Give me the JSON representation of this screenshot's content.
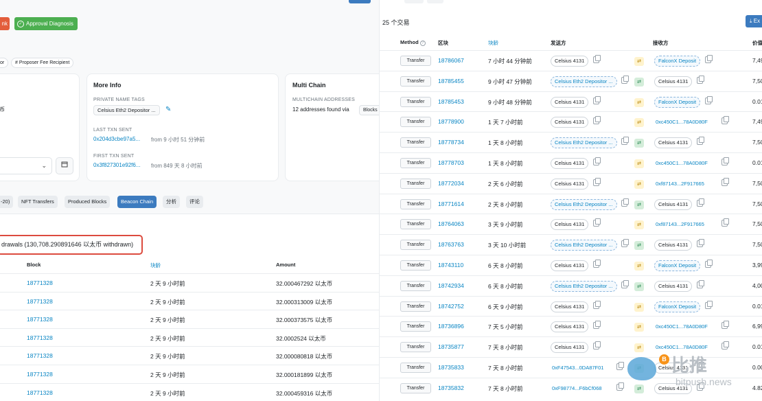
{
  "left": {
    "top_buttons": {
      "dark": "nk",
      "green": "Approval Diagnosis"
    },
    "chips": [
      "or",
      "# Proposer Fee Recipient"
    ],
    "overview_fragment": "币",
    "more_info": {
      "title": "More Info",
      "private_tags_label": "PRIVATE NAME TAGS",
      "private_tag": "Celsius Eth2 Depositor ...",
      "last_txn_label": "LAST TXN SENT",
      "last_txn_hash": "0x204d3cbe97a5...",
      "last_txn_time": "from 9 小时 51 分钟前",
      "first_txn_label": "FIRST TXN SENT",
      "first_txn_hash": "0x3f827301e92f6...",
      "first_txn_time": "from 849 天 8 小时前"
    },
    "multichain": {
      "title": "Multi Chain",
      "label": "MULTICHAIN ADDRESSES",
      "text": "12 addresses found via",
      "badge": "Blocks"
    },
    "tabs": [
      "-20)",
      "NFT Transfers",
      "Produced Blocks",
      "Beacon Chain",
      "分析",
      "评论"
    ],
    "active_tab": "Beacon Chain",
    "withdrawals_title": "drawals (130,708.290891646 以太币 withdrawn)",
    "table_headers": {
      "block": "Block",
      "age": "块龄",
      "amount": "Amount"
    },
    "rows": [
      {
        "block": "18771328",
        "age": "2 天 9 小时前",
        "amount": "32.000467292 以太币"
      },
      {
        "block": "18771328",
        "age": "2 天 9 小时前",
        "amount": "32.000313009 以太币"
      },
      {
        "block": "18771328",
        "age": "2 天 9 小时前",
        "amount": "32.000373575 以太币"
      },
      {
        "block": "18771328",
        "age": "2 天 9 小时前",
        "amount": "32.0002524 以太币"
      },
      {
        "block": "18771328",
        "age": "2 天 9 小时前",
        "amount": "32.000080818 以太币"
      },
      {
        "block": "18771328",
        "age": "2 天 9 小时前",
        "amount": "32.000181899 以太币"
      },
      {
        "block": "18771328",
        "age": "2 天 9 小时前",
        "amount": "32.000459316 以太币"
      }
    ]
  },
  "right": {
    "count": "25 个交易",
    "export": "Ex",
    "headers": {
      "method": "Method",
      "block": "区块",
      "age": "块龄",
      "from": "发送方",
      "to": "接收方",
      "value": "价值"
    },
    "rows": [
      {
        "method": "Transfer",
        "block": "18786067",
        "age": "7 小时 44 分钟前",
        "from": "Celsius 4131",
        "from_style": "plain",
        "dir": "out",
        "to": "FalconX Deposit",
        "to_style": "dash",
        "value": "7,49"
      },
      {
        "method": "Transfer",
        "block": "18785455",
        "age": "9 小时 47 分钟前",
        "from": "Celsius Eth2 Depositor ...",
        "from_style": "dash",
        "dir": "in",
        "to": "Celsius 4131",
        "to_style": "plain",
        "value": "7,50"
      },
      {
        "method": "Transfer",
        "block": "18785453",
        "age": "9 小时 48 分钟前",
        "from": "Celsius 4131",
        "from_style": "plain",
        "dir": "out",
        "to": "FalconX Deposit",
        "to_style": "dash",
        "value": "0.01"
      },
      {
        "method": "Transfer",
        "block": "18778900",
        "age": "1 天 7 小时前",
        "from": "Celsius 4131",
        "from_style": "plain",
        "dir": "out",
        "to": "0xc450C1...78A0D80F",
        "to_style": "link",
        "value": "7,49"
      },
      {
        "method": "Transfer",
        "block": "18778734",
        "age": "1 天 8 小时前",
        "from": "Celsius Eth2 Depositor ...",
        "from_style": "dash",
        "dir": "in",
        "to": "Celsius 4131",
        "to_style": "plain",
        "value": "7,50"
      },
      {
        "method": "Transfer",
        "block": "18778703",
        "age": "1 天 8 小时前",
        "from": "Celsius 4131",
        "from_style": "plain",
        "dir": "out",
        "to": "0xc450C1...78A0D80F",
        "to_style": "link",
        "value": "0.01"
      },
      {
        "method": "Transfer",
        "block": "18772034",
        "age": "2 天 6 小时前",
        "from": "Celsius 4131",
        "from_style": "plain",
        "dir": "out",
        "to": "0xf87143...2F917665",
        "to_style": "link",
        "value": "7,50"
      },
      {
        "method": "Transfer",
        "block": "18771614",
        "age": "2 天 8 小时前",
        "from": "Celsius Eth2 Depositor ...",
        "from_style": "dash",
        "dir": "in",
        "to": "Celsius 4131",
        "to_style": "plain",
        "value": "7,50"
      },
      {
        "method": "Transfer",
        "block": "18764063",
        "age": "3 天 9 小时前",
        "from": "Celsius 4131",
        "from_style": "plain",
        "dir": "out",
        "to": "0xf87143...2F917665",
        "to_style": "link",
        "value": "7,50"
      },
      {
        "method": "Transfer",
        "block": "18763763",
        "age": "3 天 10 小时前",
        "from": "Celsius Eth2 Depositor ...",
        "from_style": "dash",
        "dir": "in",
        "to": "Celsius 4131",
        "to_style": "plain",
        "value": "7,50"
      },
      {
        "method": "Transfer",
        "block": "18743110",
        "age": "6 天 8 小时前",
        "from": "Celsius 4131",
        "from_style": "plain",
        "dir": "out",
        "to": "FalconX Deposit",
        "to_style": "dash",
        "value": "3,99"
      },
      {
        "method": "Transfer",
        "block": "18742934",
        "age": "6 天 8 小时前",
        "from": "Celsius Eth2 Depositor ...",
        "from_style": "dash",
        "dir": "in",
        "to": "Celsius 4131",
        "to_style": "plain",
        "value": "4,00"
      },
      {
        "method": "Transfer",
        "block": "18742752",
        "age": "6 天 9 小时前",
        "from": "Celsius 4131",
        "from_style": "plain",
        "dir": "out",
        "to": "FalconX Deposit",
        "to_style": "dash",
        "value": "0.01"
      },
      {
        "method": "Transfer",
        "block": "18736896",
        "age": "7 天 5 小时前",
        "from": "Celsius 4131",
        "from_style": "plain",
        "dir": "out",
        "to": "0xc450C1...78A0D80F",
        "to_style": "link",
        "value": "6,99"
      },
      {
        "method": "Transfer",
        "block": "18735877",
        "age": "7 天 8 小时前",
        "from": "Celsius 4131",
        "from_style": "plain",
        "dir": "out",
        "to": "0xc450C1...78A0D80F",
        "to_style": "link",
        "value": "0.01"
      },
      {
        "method": "Transfer",
        "block": "18735833",
        "age": "7 天 8 小时前",
        "from": "0xF47543...0DA87F01",
        "from_style": "link",
        "dir": "in",
        "to": "Celsius 4131",
        "to_style": "plain",
        "value": "0.00"
      },
      {
        "method": "Transfer",
        "block": "18735832",
        "age": "7 天 8 小时前",
        "from": "0xF98774...F6bCf068",
        "from_style": "link",
        "dir": "in",
        "to": "Celsius 4131",
        "to_style": "plain",
        "value": "4.82"
      }
    ]
  },
  "watermark": {
    "cn": "比推",
    "url": "bitpush.news",
    "coin": "B"
  }
}
